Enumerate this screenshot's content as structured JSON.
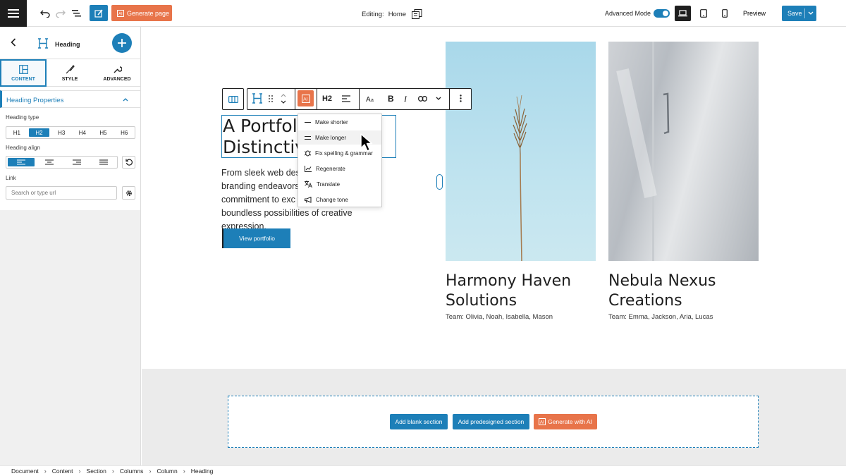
{
  "topbar": {
    "generate_page_label": "Generate page",
    "editing_label": "Editing:",
    "editing_page": "Home",
    "advanced_mode_label": "Advanced Mode",
    "advanced_mode_on": true,
    "preview_label": "Preview",
    "save_label": "Save"
  },
  "sidebar": {
    "block_title": "Heading",
    "tabs": [
      {
        "label": "CONTENT",
        "active": true
      },
      {
        "label": "STYLE",
        "active": false
      },
      {
        "label": "ADVANCED",
        "active": false
      }
    ],
    "panel_title": "Heading Properties",
    "heading_type_label": "Heading type",
    "heading_types": [
      "H1",
      "H2",
      "H3",
      "H4",
      "H5",
      "H6"
    ],
    "heading_type_selected": "H2",
    "heading_align_label": "Heading align",
    "link_label": "Link",
    "link_placeholder": "Search or type url"
  },
  "toolbar": {
    "heading_level": "H2"
  },
  "ai_menu": {
    "items": [
      {
        "label": "Make shorter",
        "icon": "line-icon"
      },
      {
        "label": "Make longer",
        "icon": "lines-icon"
      },
      {
        "label": "Fix spelling & grammar",
        "icon": "bug-icon"
      },
      {
        "label": "Regenerate",
        "icon": "chart-icon"
      },
      {
        "label": "Translate",
        "icon": "translate-icon"
      },
      {
        "label": "Change tone",
        "icon": "megaphone-icon"
      }
    ]
  },
  "hero": {
    "heading": "A Portfoli\nDistinctive",
    "paragraph": "From sleek web des\nbranding endeavors ur\ncommitment to exc\nboundless possibilities of creative expression.",
    "button_label": "View portfolio"
  },
  "cards": [
    {
      "title": "Harmony Haven\nSolutions",
      "team": "Team: Olivia, Noah, Isabella, Mason"
    },
    {
      "title": "Nebula Nexus\nCreations",
      "team": "Team: Emma, Jackson, Aria, Lucas"
    }
  ],
  "add_section": {
    "blank_label": "Add blank section",
    "predesigned_label": "Add predesigned section",
    "ai_label": "Generate with AI"
  },
  "breadcrumbs": [
    "Document",
    "Content",
    "Section",
    "Columns",
    "Column",
    "Heading"
  ],
  "colors": {
    "accent": "#1d7fb8",
    "ai_orange": "#e8744a",
    "dark": "#1e1e1e"
  }
}
